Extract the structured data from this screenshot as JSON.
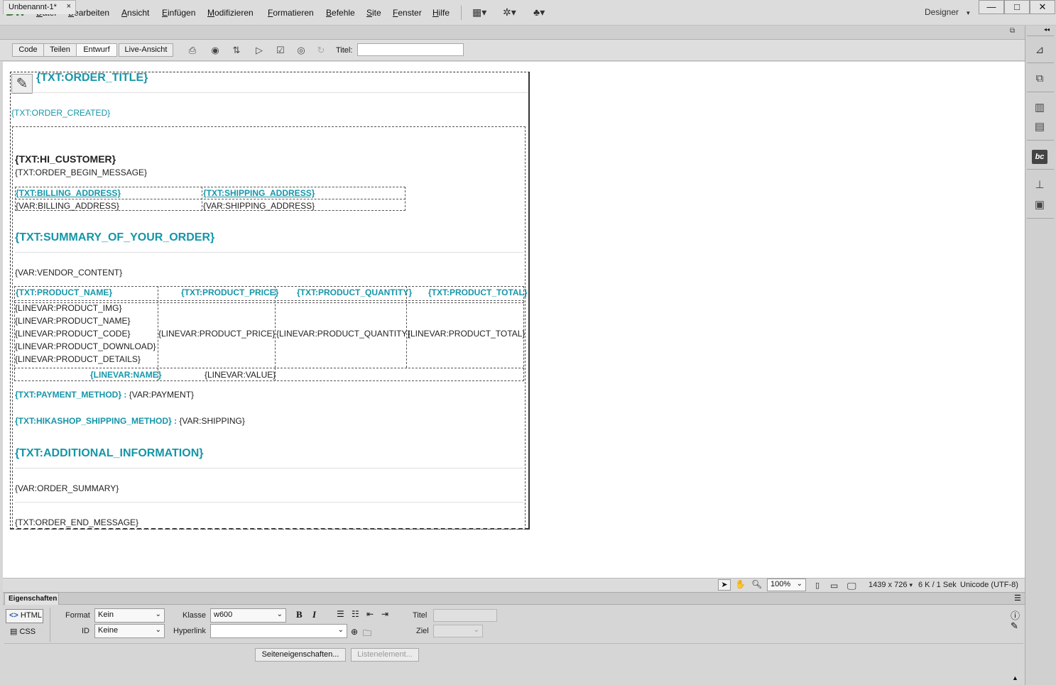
{
  "app": {
    "logo": "Dw",
    "menu": [
      "Datei",
      "Bearbeiten",
      "Ansicht",
      "Einfügen",
      "Modifizieren",
      "Formatieren",
      "Befehle",
      "Site",
      "Fenster",
      "Hilfe"
    ],
    "workspace": "Designer",
    "window_controls": [
      "—",
      "□",
      "✕"
    ]
  },
  "document_tab": {
    "name": "Unbenannt-1*",
    "close": "×"
  },
  "toolbar": {
    "views": [
      "Code",
      "Teilen",
      "Entwurf",
      "Live-Ansicht"
    ],
    "active_view": "Entwurf",
    "title_label": "Titel:",
    "title_value": ""
  },
  "doc": {
    "order_title": "{TXT:ORDER_TITLE}",
    "order_created": "{TXT:ORDER_CREATED}",
    "hi_customer": "{TXT:HI_CUSTOMER}",
    "begin_message": "{TXT:ORDER_BEGIN_MESSAGE}",
    "billing_label": "{TXT:BILLING_ADDRESS}",
    "shipping_label": "{TXT:SHIPPING_ADDRESS}",
    "billing_value": "{VAR:BILLING_ADDRESS}",
    "shipping_value": "{VAR:SHIPPING_ADDRESS}",
    "summary_heading": "{TXT:SUMMARY_OF_YOUR_ORDER}",
    "vendor_content": "{VAR:VENDOR_CONTENT}",
    "product_headers": [
      "{TXT:PRODUCT_NAME}",
      "{TXT:PRODUCT_PRICE}",
      "{TXT:PRODUCT_QUANTITY}",
      "{TXT:PRODUCT_TOTAL}"
    ],
    "product_lines": [
      "{LINEVAR:PRODUCT_IMG}",
      "{LINEVAR:PRODUCT_NAME}",
      "{LINEVAR:PRODUCT_CODE}",
      "{LINEVAR:PRODUCT_DOWNLOAD}",
      "{LINEVAR:PRODUCT_DETAILS}"
    ],
    "product_price": "{LINEVAR:PRODUCT_PRICE}",
    "product_quantity": "{LINEVAR:PRODUCT_QUANTITY}",
    "product_total": "{LINEVAR:PRODUCT_TOTAL}",
    "linevar_name": "{LINEVAR:NAME}",
    "linevar_value": "{LINEVAR:VALUE}",
    "payment_label": "{TXT:PAYMENT_METHOD}",
    "payment_sep": " : ",
    "payment_value": "{VAR:PAYMENT}",
    "shipping_method_label": "{TXT:HIKASHOP_SHIPPING_METHOD}",
    "shipping_method_value": "{VAR:SHIPPING}",
    "additional_heading": "{TXT:ADDITIONAL_INFORMATION}",
    "order_summary": "{VAR:ORDER_SUMMARY}",
    "end_message": "{TXT:ORDER_END_MESSAGE}"
  },
  "statusbar": {
    "zoom": "100%",
    "dimensions": "1439 x 726",
    "size": "6 K / 1 Sek",
    "encoding": "Unicode (UTF-8)"
  },
  "properties": {
    "tab": "Eigenschaften",
    "html_btn": "HTML",
    "css_btn": "CSS",
    "format_label": "Format",
    "format_value": "Kein",
    "id_label": "ID",
    "id_value": "Keine",
    "class_label": "Klasse",
    "class_value": "w600",
    "hyperlink_label": "Hyperlink",
    "hyperlink_value": "",
    "title_label": "Titel",
    "target_label": "Ziel",
    "page_props_btn": "Seiteneigenschaften...",
    "list_item_btn": "Listenelement..."
  }
}
